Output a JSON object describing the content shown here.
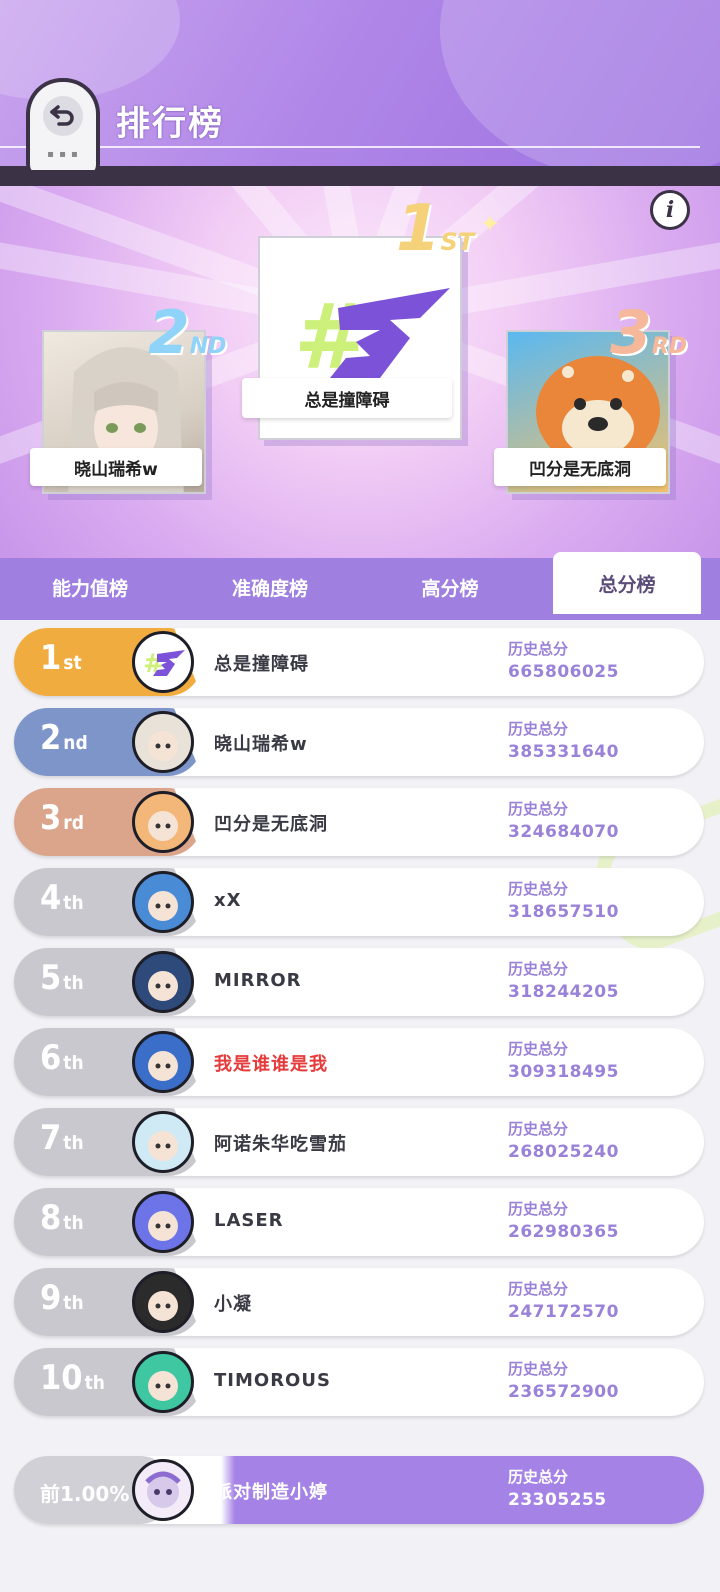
{
  "header": {
    "title": "排行榜",
    "back_icon": "back-arrow-icon"
  },
  "podium": {
    "first": {
      "rank_num": "1",
      "rank_suffix": "ST",
      "name": "总是撞障碍",
      "avatar_text": "#3",
      "color": "#f5d27a"
    },
    "second": {
      "rank_num": "2",
      "rank_suffix": "ND",
      "name": "晓山瑞希w",
      "color": "#8fd3f8"
    },
    "third": {
      "rank_num": "3",
      "rank_suffix": "RD",
      "name": "凹分是无底洞",
      "color": "#f5b89a"
    },
    "info_label": "i"
  },
  "tabs": [
    {
      "label": "能力值榜",
      "active": false
    },
    {
      "label": "准确度榜",
      "active": false
    },
    {
      "label": "高分榜",
      "active": false
    },
    {
      "label": "总分榜",
      "active": true
    }
  ],
  "score_label": "历史总分",
  "rows": [
    {
      "rank": "1",
      "suffix": "st",
      "name": "总是撞障碍",
      "score": "665806025",
      "color": "#f0ac3e"
    },
    {
      "rank": "2",
      "suffix": "nd",
      "name": "晓山瑞希w",
      "score": "385331640",
      "color": "#7d95c9"
    },
    {
      "rank": "3",
      "suffix": "rd",
      "name": "凹分是无底洞",
      "score": "324684070",
      "color": "#dba58c"
    },
    {
      "rank": "4",
      "suffix": "th",
      "name": "xX",
      "score": "318657510",
      "color": "#c8c8ce"
    },
    {
      "rank": "5",
      "suffix": "th",
      "name": "MIRROR",
      "score": "318244205",
      "color": "#c8c8ce"
    },
    {
      "rank": "6",
      "suffix": "th",
      "name": "我是谁谁是我",
      "score": "309318495",
      "color": "#c8c8ce",
      "highlight": "#e53b3b"
    },
    {
      "rank": "7",
      "suffix": "th",
      "name": "阿诺朱华吃雪茄",
      "score": "268025240",
      "color": "#c8c8ce"
    },
    {
      "rank": "8",
      "suffix": "th",
      "name": "LASER",
      "score": "262980365",
      "color": "#c8c8ce"
    },
    {
      "rank": "9",
      "suffix": "th",
      "name": "小凝",
      "score": "247172570",
      "color": "#c8c8ce"
    },
    {
      "rank": "10",
      "suffix": "th",
      "name": "TIMOROUS",
      "score": "236572900",
      "color": "#c8c8ce"
    }
  ],
  "me": {
    "rank_text": "前1.00%",
    "name": "派对制造小婷",
    "score": "23305255"
  }
}
